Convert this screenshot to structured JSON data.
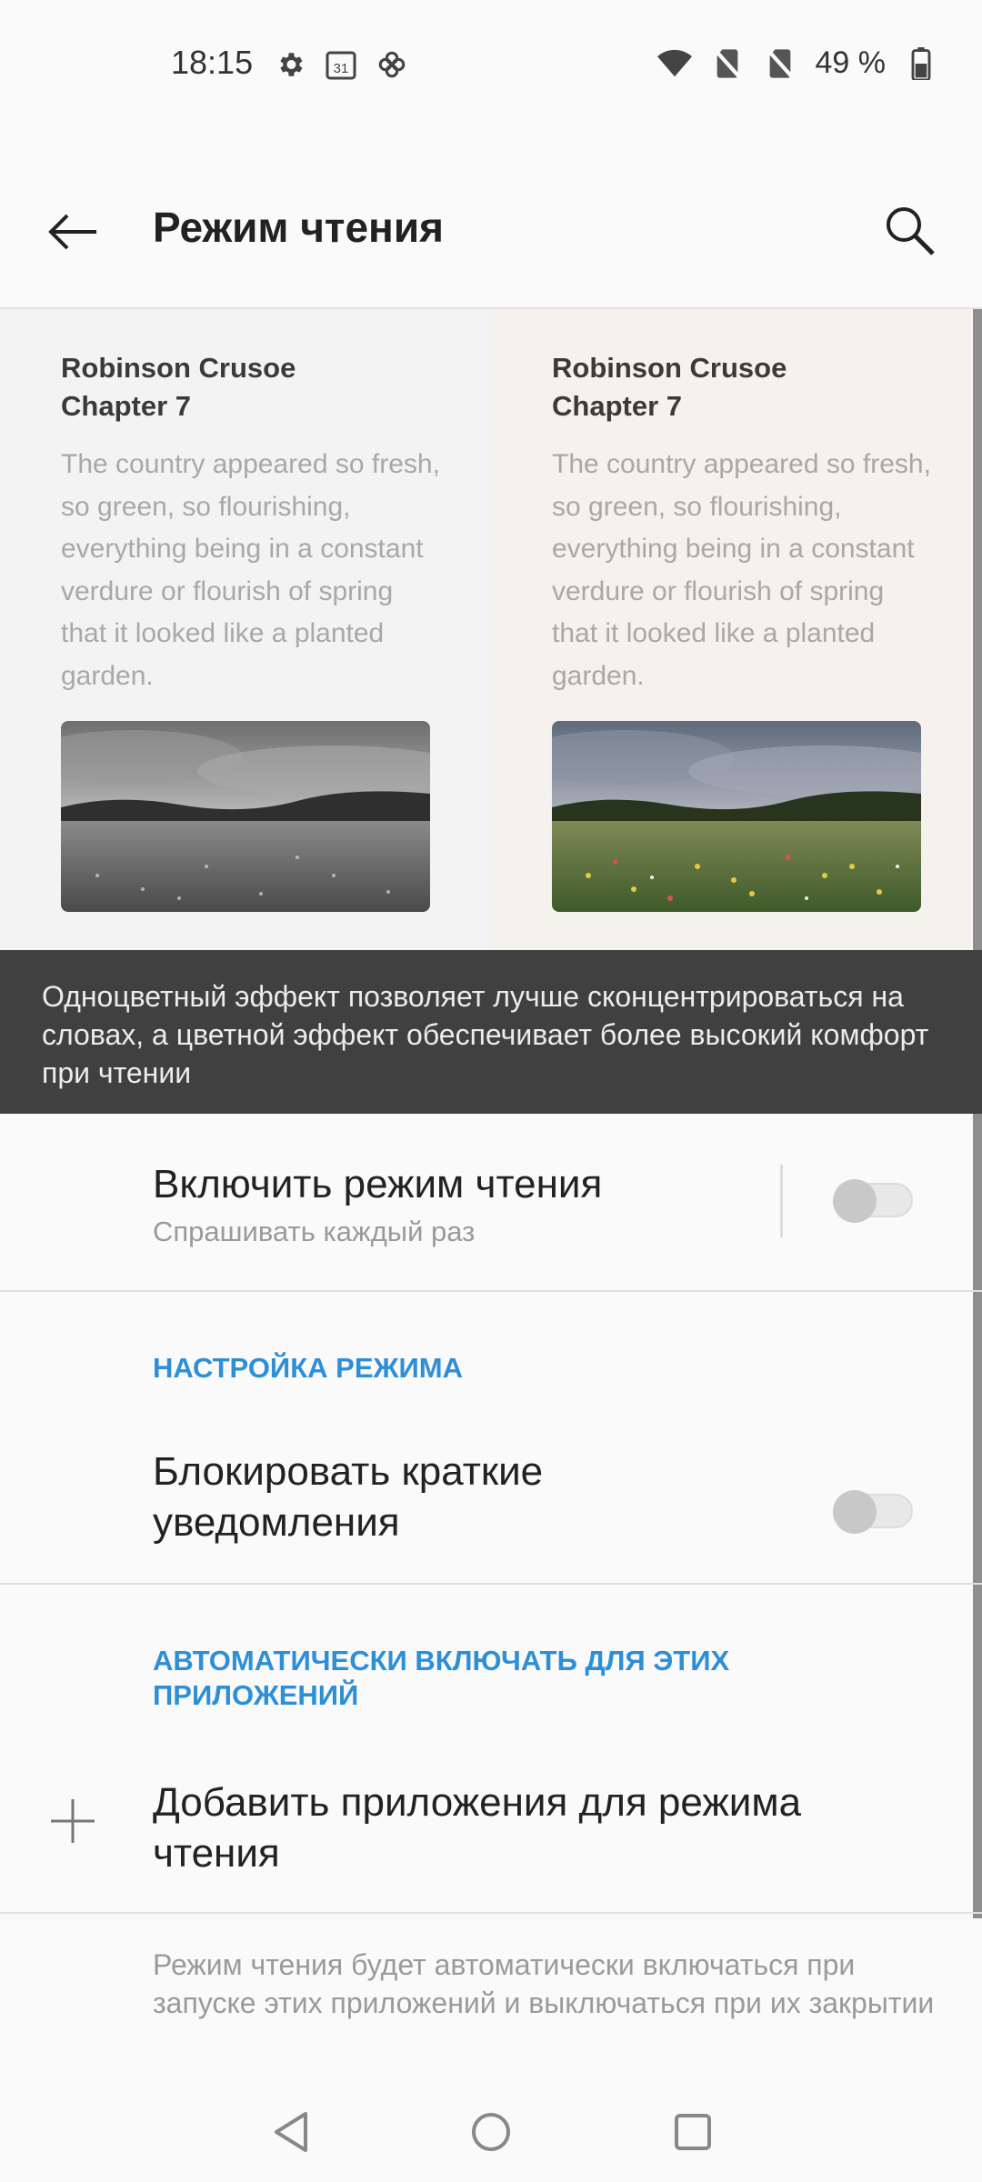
{
  "status_bar": {
    "time": "18:15",
    "battery_text": "49 %",
    "left_icons": [
      "settings-icon",
      "calendar-icon",
      "pinwheel-icon"
    ],
    "calendar_day": "31",
    "right_icons": [
      "wifi-icon",
      "no-sim-icon",
      "no-sim-icon",
      "battery-icon"
    ]
  },
  "appbar": {
    "title": "Режим чтения"
  },
  "preview": {
    "mono": {
      "title_line1": "Robinson Crusoe",
      "title_line2": "Chapter 7",
      "text": "The country appeared so fresh, so green, so flourishing, everything being in a constant verdure or flourish of spring that it looked like a planted garden."
    },
    "color": {
      "title_line1": "Robinson Crusoe",
      "title_line2": "Chapter 7",
      "text": "The country appeared so fresh, so green, so flourishing, everything being in a constant verdure or flourish of spring that it looked like a planted garden."
    }
  },
  "info_banner": {
    "text": "Одноцветный эффект позволяет лучше сконцентрироваться на словах, а цветной эффект обеспечивает более высокий комфорт при чтении"
  },
  "enable_row": {
    "title": "Включить режим чтения",
    "subtitle": "Спрашивать каждый раз",
    "enabled": false
  },
  "section_mode": {
    "header": "НАСТРОЙКА РЕЖИМА"
  },
  "block_row": {
    "title": "Блокировать краткие уведомления",
    "enabled": false
  },
  "section_auto": {
    "header": "АВТОМАТИЧЕСКИ ВКЛЮЧАТЬ ДЛЯ ЭТИХ ПРИЛОЖЕНИЙ"
  },
  "add_row": {
    "title": "Добавить приложения для режима чтения"
  },
  "footer_note": "Режим чтения будет автоматически включаться при запуске этих приложений и выключаться при их закрытии",
  "colors": {
    "accent": "#2e8fd6",
    "banner_bg": "#404040",
    "preview_mono_bg": "#f3f3f3",
    "preview_color_bg": "#f5f1ec"
  }
}
